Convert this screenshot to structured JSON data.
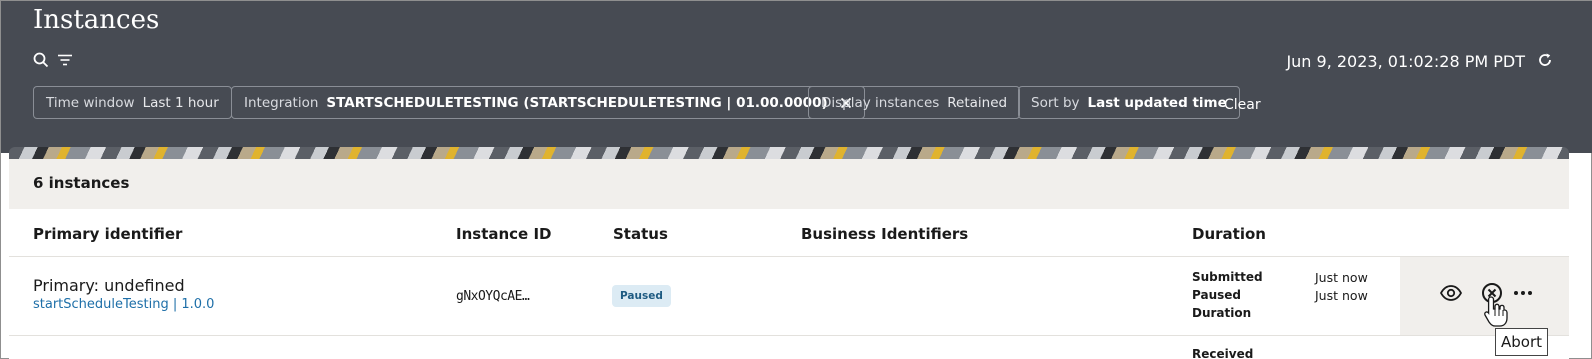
{
  "header": {
    "title": "Instances",
    "timestamp": "Jun 9, 2023, 01:02:28 PM PDT",
    "icons": [
      "search-icon",
      "filter-icon",
      "refresh-icon"
    ]
  },
  "filters": {
    "time_window": {
      "key": "Time window",
      "value": "Last 1 hour"
    },
    "integration": {
      "key": "Integration",
      "value": "STARTSCHEDULETESTING (STARTSCHEDULETESTING | 01.00.0000)"
    },
    "display": {
      "key": "Display instances",
      "value": "Retained"
    },
    "sort": {
      "key": "Sort by",
      "value": "Last updated time"
    },
    "clear_label": "Clear"
  },
  "list": {
    "count_label": "6 instances",
    "columns": [
      "Primary identifier",
      "Instance ID",
      "Status",
      "Business Identifiers",
      "Duration"
    ],
    "rows": [
      {
        "primary": "Primary: undefined",
        "integration_link": "startScheduleTesting | 1.0.0",
        "instance_id": "gNxOYQcAE…",
        "status": "Paused",
        "duration_keys": [
          "Submitted",
          "Paused",
          "Duration"
        ],
        "duration_values": [
          "Just now",
          "Just now"
        ]
      }
    ],
    "next_row_partial": "Received"
  },
  "tooltip": "Abort",
  "colors": {
    "header_bg": "#474b53",
    "link": "#1e6fa8",
    "status_badge_bg": "#dcebf4",
    "status_badge_text": "#1e5b82"
  }
}
